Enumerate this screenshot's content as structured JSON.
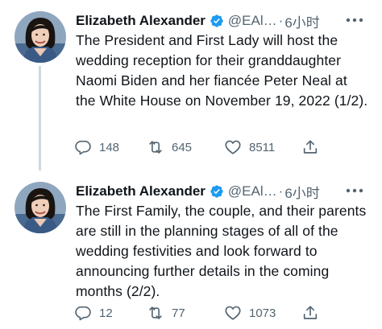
{
  "colors": {
    "text": "#0f1419",
    "secondary": "#536471",
    "verified": "#1d9bf0",
    "thread_line": "#cfd9de"
  },
  "tweets": [
    {
      "author": {
        "display_name": "Elizabeth Alexander",
        "handle": "@EAl…",
        "verified_icon": "verified-badge-icon"
      },
      "separator": "·",
      "time": "6小时",
      "text": "The President and First Lady will host the wedding reception for their granddaughter Naomi Biden and her fiancée Peter Neal at the White House on November 19, 2022 (1/2).",
      "actions": {
        "replies": "148",
        "retweets": "645",
        "likes": "8511"
      }
    },
    {
      "author": {
        "display_name": "Elizabeth Alexander",
        "handle": "@EAl…",
        "verified_icon": "verified-badge-icon"
      },
      "separator": "·",
      "time": "6小时",
      "text": "The First Family, the couple, and their parents are still in the planning stages of all of the wedding festivities and look forward to announcing further details in the coming months (2/2).",
      "actions": {
        "replies": "12",
        "retweets": "77",
        "likes": "1073"
      }
    }
  ]
}
